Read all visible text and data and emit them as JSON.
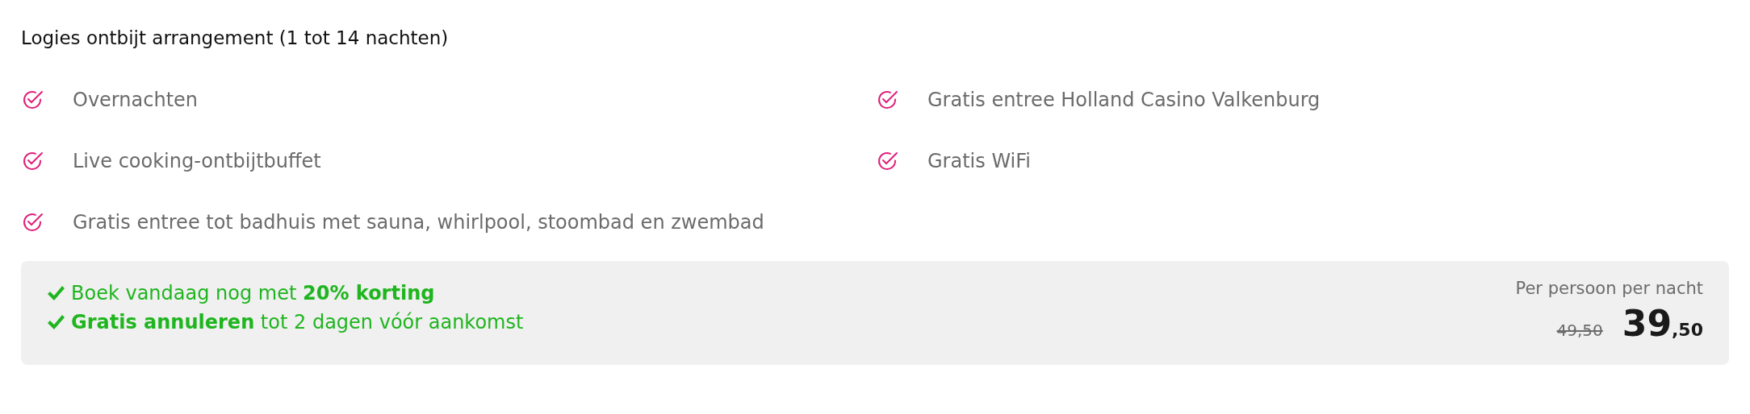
{
  "title": "Logies ontbijt arrangement (1 tot 14 nachten)",
  "features": [
    "Overnachten",
    "Live cooking-ontbijtbuffet",
    "Gratis entree tot badhuis met sauna, whirlpool, stoombad en zwembad",
    "Gratis entree Holland Casino Valkenburg",
    "Gratis WiFi"
  ],
  "benefits": [
    "Boek vandaag nog met **20% korting**",
    "**Gratis annuleren** tot 2 dagen vóór aankomst"
  ],
  "price": {
    "label": "Per persoon per nacht",
    "old": "49,50",
    "main": "39",
    "cents": ",50"
  }
}
